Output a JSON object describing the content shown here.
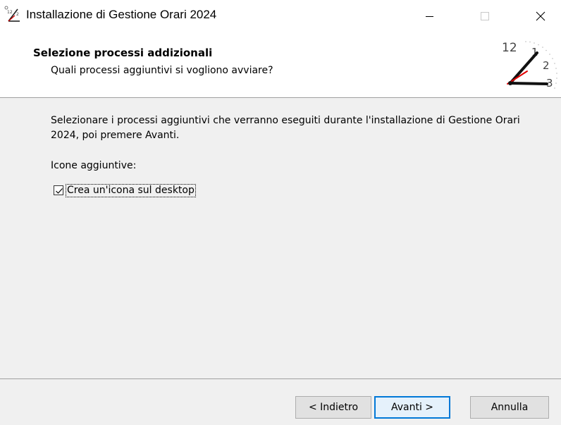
{
  "window": {
    "title": "Installazione di Gestione Orari 2024",
    "icon": "clock-app-icon"
  },
  "header": {
    "title": "Selezione processi addizionali",
    "subtitle": "Quali processi aggiuntivi si vogliono avviare?",
    "logo_numbers": [
      "12",
      "1",
      "2",
      "3"
    ]
  },
  "body": {
    "description": "Selezionare i processi aggiuntivi che verranno eseguiti durante l'installazione di Gestione Orari 2024, poi premere Avanti.",
    "section_label": "Icone aggiuntive:",
    "checkbox": {
      "label": "Crea un'icona sul desktop",
      "checked": true
    }
  },
  "buttons": {
    "back": "< Indietro",
    "next": "Avanti >",
    "cancel": "Annulla"
  },
  "colors": {
    "accent": "#0078d7",
    "clock_hand_red": "#e00000"
  }
}
